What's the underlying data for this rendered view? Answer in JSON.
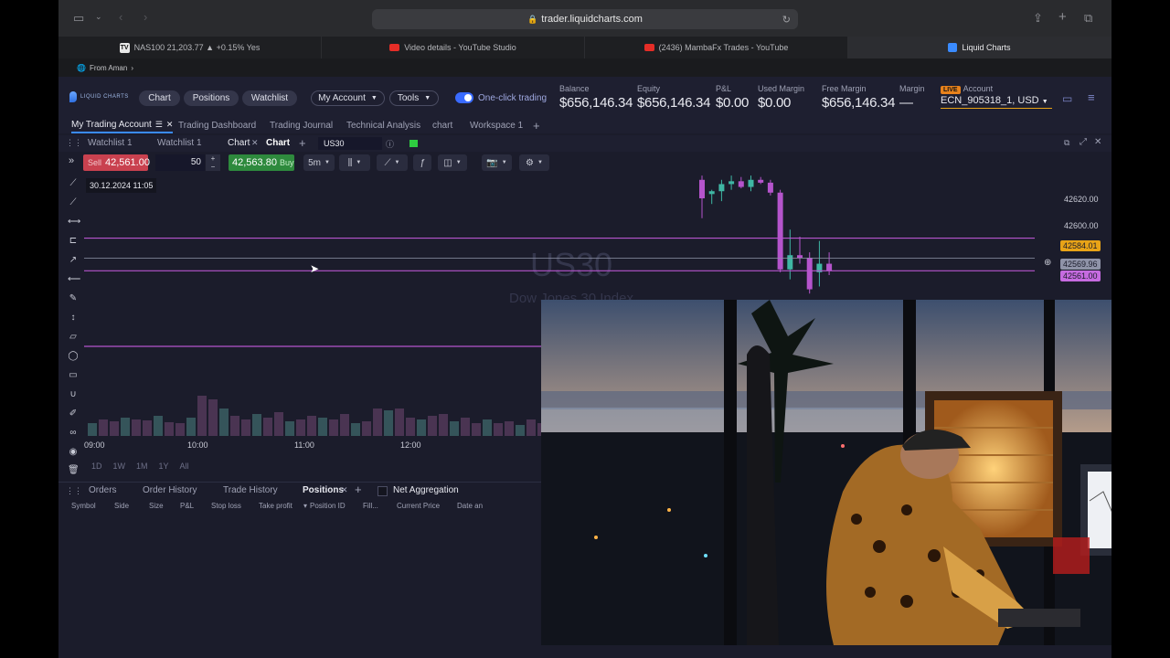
{
  "browser": {
    "url": "trader.liquidcharts.com",
    "tabs": [
      {
        "label": "NAS100 21,203.77 ▲ +0.15% Yes",
        "icon": "tradingview-icon"
      },
      {
        "label": "Video details - YouTube Studio",
        "icon": "youtube-icon"
      },
      {
        "label": "(2436) MambaFx Trades - YouTube",
        "icon": "youtube-icon"
      },
      {
        "label": "Liquid Charts",
        "icon": "liquidcharts-icon"
      }
    ],
    "favorites_label": "From Aman"
  },
  "app": {
    "brand": "LIQUID CHARTS",
    "nav": [
      "Chart",
      "Positions",
      "Watchlist"
    ],
    "my_account": "My Account",
    "tools": "Tools",
    "one_click": "One-click trading",
    "stats": [
      {
        "label": "Balance",
        "value": "$656,146.34"
      },
      {
        "label": "Equity",
        "value": "$656,146.34"
      },
      {
        "label": "P&L",
        "value": "$0.00"
      },
      {
        "label": "Used Margin",
        "value": "$0.00"
      },
      {
        "label": "Free Margin",
        "value": "$656,146.34"
      },
      {
        "label": "Margin",
        "value": "—"
      }
    ],
    "live_badge": "LIVE",
    "account_label": "Account",
    "account_value": "ECN_905318_1, USD"
  },
  "workspaces": [
    "My Trading Account",
    "Trading Dashboard",
    "Trading Journal",
    "Technical Analysis",
    "chart",
    "Workspace 1"
  ],
  "panel": {
    "tabs": [
      "Watchlist 1",
      "Watchlist 1",
      "Chart",
      "Chart"
    ],
    "symbol": "US30"
  },
  "toolbar": {
    "sell_label": "Sell",
    "sell_price": "42,561.00",
    "qty": "50",
    "buy_price": "42,563.80",
    "buy_label": "Buy",
    "timeframe": "5m"
  },
  "chart": {
    "crosshair_date": "30.12.2024 11:05",
    "watermark_symbol": "US30",
    "watermark_name": "Dow Jones 30 Index",
    "y_ticks": [
      "42620.00",
      "42600.00"
    ],
    "price_tags": [
      {
        "value": "42584.01",
        "color": "#e8a317"
      },
      {
        "value": "42569.96",
        "color": "#8f93a8"
      },
      {
        "value": "42561.00",
        "color": "#c66be0"
      }
    ],
    "x_ticks": [
      "09:00",
      "10:00",
      "11:00",
      "12:00"
    ],
    "ranges": [
      "1D",
      "1W",
      "1M",
      "1Y",
      "All"
    ]
  },
  "bottom": {
    "tabs": [
      "Orders",
      "Order History",
      "Trade History",
      "Positions"
    ],
    "net_aggregation": "Net Aggregation",
    "columns": [
      "Symbol",
      "Side",
      "Size",
      "P&L",
      "Stop loss",
      "Take profit",
      "Position ID",
      "Fill...",
      "Current Price",
      "Date an"
    ]
  },
  "chart_data": {
    "type": "candlestick",
    "series": [
      {
        "name": "US30",
        "candles": [
          {
            "o": 42625,
            "h": 42628,
            "l": 42598,
            "c": 42612
          },
          {
            "o": 42615,
            "h": 42618,
            "l": 42608,
            "c": 42617
          },
          {
            "o": 42617,
            "h": 42625,
            "l": 42610,
            "c": 42622
          },
          {
            "o": 42622,
            "h": 42628,
            "l": 42618,
            "c": 42624
          },
          {
            "o": 42624,
            "h": 42627,
            "l": 42619,
            "c": 42620
          },
          {
            "o": 42620,
            "h": 42628,
            "l": 42617,
            "c": 42625
          },
          {
            "o": 42625,
            "h": 42627,
            "l": 42622,
            "c": 42623
          },
          {
            "o": 42623,
            "h": 42625,
            "l": 42614,
            "c": 42616
          },
          {
            "o": 42616,
            "h": 42618,
            "l": 42560,
            "c": 42562
          },
          {
            "o": 42562,
            "h": 42590,
            "l": 42555,
            "c": 42572
          },
          {
            "o": 42572,
            "h": 42585,
            "l": 42566,
            "c": 42570
          },
          {
            "o": 42570,
            "h": 42574,
            "l": 42545,
            "c": 42548
          },
          {
            "o": 42560,
            "h": 42582,
            "l": 42550,
            "c": 42566
          },
          {
            "o": 42566,
            "h": 42574,
            "l": 42558,
            "c": 42561
          }
        ]
      }
    ],
    "y_range": [
      42540,
      42630
    ]
  },
  "colors": {
    "accent": "#3a8bff",
    "sell": "#d34d5c",
    "buy": "#2ea043",
    "bear": "#b554cc",
    "bull": "#3fb7a4"
  }
}
